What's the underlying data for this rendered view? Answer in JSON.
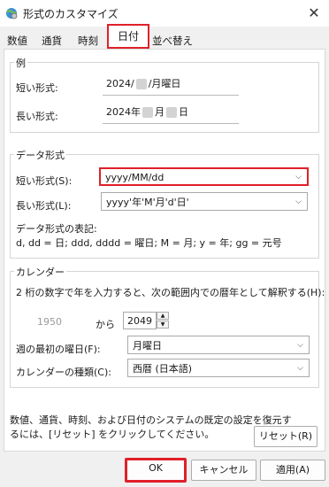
{
  "window": {
    "title": "形式のカスタマイズ",
    "close_glyph": "✕"
  },
  "tabs": [
    "数値",
    "通貨",
    "時刻",
    "日付",
    "並べ替え"
  ],
  "active_tab": "日付",
  "example": {
    "legend": "例",
    "short_label": "短い形式:",
    "short_value_prefix": "2024/",
    "short_value_suffix": "/月曜日",
    "long_label": "長い形式:",
    "long_value_a": "2024年",
    "long_value_b": "月",
    "long_value_c": "日"
  },
  "data_format": {
    "legend": "データ形式",
    "short_label": "短い形式(S):",
    "short_value": "yyyy/MM/dd",
    "long_label": "長い形式(L):",
    "long_value": "yyyy'年'M'月'd'日'",
    "notation_title": "データ形式の表記:",
    "notation_text": "d, dd = 日;  ddd, dddd = 曜日; M = 月; y = 年; gg = 元号"
  },
  "calendar": {
    "legend": "カレンダー",
    "two_digit_text": "2 桁の数字で年を入力すると、次の範囲内での暦年として解釈する(H):",
    "range_from": "1950",
    "range_mid": "から",
    "range_to": "2049",
    "first_day_label": "週の最初の曜日(F):",
    "first_day_value": "月曜日",
    "type_label": "カレンダーの種類(C):",
    "type_value": "西暦 (日本語)"
  },
  "footer": {
    "restore_text_1": "数値、通貨、時刻、および日付のシステムの既定の設定を復元す",
    "restore_text_2": "るには、[リセット] をクリックしてください。",
    "reset_label": "リセット(R)"
  },
  "buttons": {
    "ok": "OK",
    "cancel": "キャンセル",
    "apply": "適用(A)"
  },
  "colors": {
    "highlight": "#e0202a"
  }
}
